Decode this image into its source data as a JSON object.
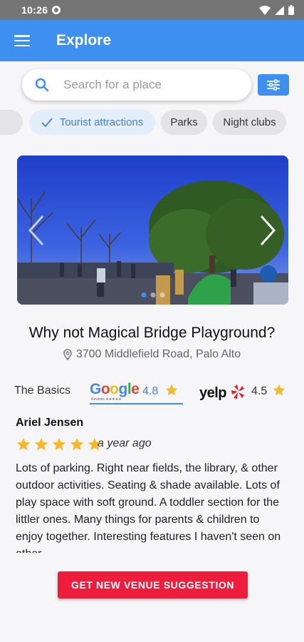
{
  "status_bar": {
    "time": "10:26"
  },
  "app_bar": {
    "title": "Explore"
  },
  "search": {
    "placeholder": "Search for a place"
  },
  "chips": [
    {
      "label": "Tourist attractions",
      "selected": true
    },
    {
      "label": "Parks",
      "selected": false
    },
    {
      "label": "Night clubs",
      "selected": false
    }
  ],
  "carousel": {
    "image_count": 3,
    "active_index": 0
  },
  "venue": {
    "name": "Why not Magical Bridge Playground?",
    "address": "3700 Middlefield Road, Palo Alto"
  },
  "ratings": {
    "basics_label": "The Basics",
    "google": {
      "logo": "Google",
      "sub": "Reviews ★★★★★",
      "rating": "4.8"
    },
    "yelp": {
      "logo": "yelp",
      "rating": "4.5"
    }
  },
  "review": {
    "author": "Ariel Jensen",
    "stars": 5,
    "time": "a year ago",
    "text": "Lots of parking. Right near fields, the library, & other outdoor activities. Seating & shade available. Lots of play space with soft ground. A toddler section for the littler ones. Many things for parents & children to enjoy together. Interesting features I haven't seen on other"
  },
  "cta": {
    "label": "GET NEW VENUE SUGGESTION"
  },
  "colors": {
    "primary": "#3d8ff0",
    "accent_red": "#ee1d3c",
    "star": "#f5b82e",
    "chip_selected_bg": "#e3eefb"
  }
}
